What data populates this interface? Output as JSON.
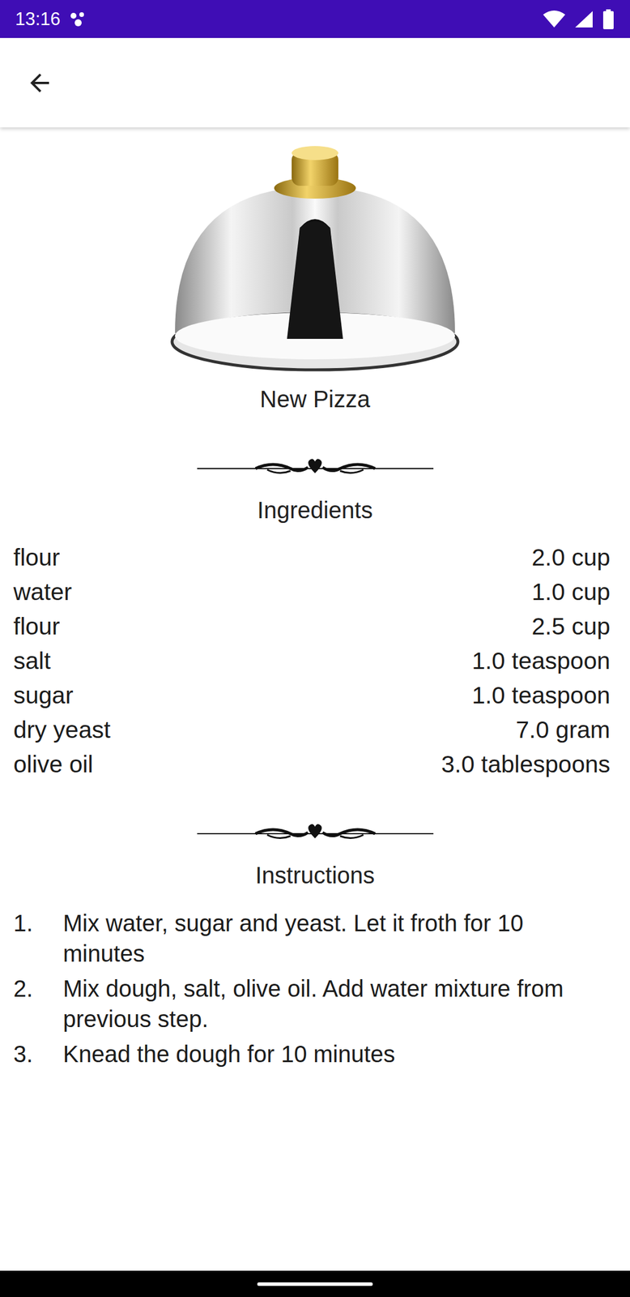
{
  "status_bar": {
    "time": "13:16"
  },
  "recipe": {
    "title": "New Pizza"
  },
  "ingredients": {
    "heading": "Ingredients",
    "items": [
      {
        "name": "flour",
        "amount": "2.0 cup"
      },
      {
        "name": "water",
        "amount": "1.0 cup"
      },
      {
        "name": "flour",
        "amount": "2.5 cup"
      },
      {
        "name": "salt",
        "amount": "1.0 teaspoon"
      },
      {
        "name": "sugar",
        "amount": "1.0 teaspoon"
      },
      {
        "name": "dry yeast",
        "amount": "7.0 gram"
      },
      {
        "name": "olive oil",
        "amount": "3.0 tablespoons"
      }
    ]
  },
  "instructions": {
    "heading": "Instructions",
    "steps": [
      {
        "number": "1.",
        "text": "Mix water, sugar and yeast. Let it froth for 10 minutes"
      },
      {
        "number": "2.",
        "text": "Mix dough, salt, olive oil. Add water mixture from previous step."
      },
      {
        "number": "3.",
        "text": "Knead the dough for 10 minutes"
      }
    ]
  }
}
